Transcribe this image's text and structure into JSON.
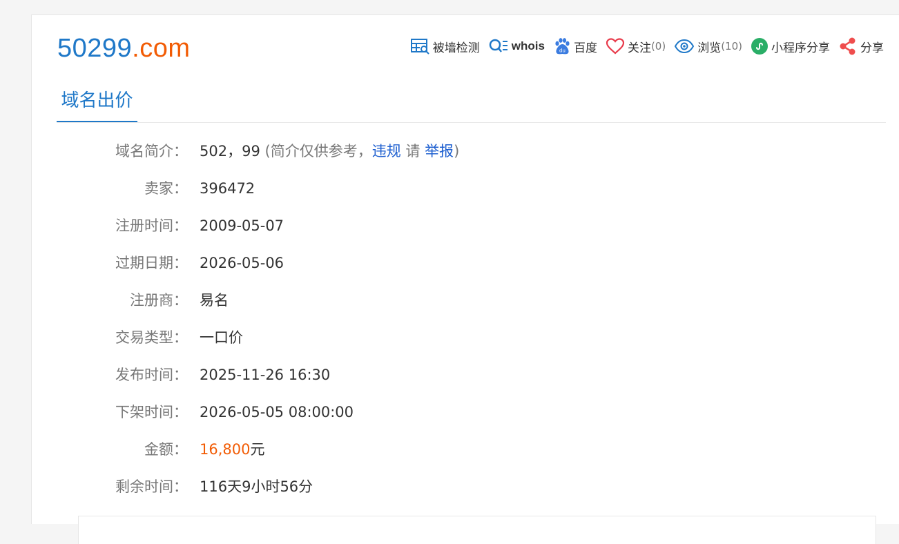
{
  "domain": {
    "name": "50299",
    "tld": ".com"
  },
  "toolbar": {
    "wall_check": "被墙检测",
    "whois": "whois",
    "baidu": "百度",
    "follow": "关注",
    "follow_count": "(0)",
    "views": "浏览",
    "views_count": "(10)",
    "miniprogram_share": "小程序分享",
    "share": "分享"
  },
  "tabs": {
    "active": "域名出价"
  },
  "info": {
    "intro": {
      "label": "域名简介：",
      "value": "502，99",
      "note_open": "(简介仅供参考，",
      "violation": "违规",
      "please": " 请 ",
      "report": "举报",
      "note_close": ")"
    },
    "seller": {
      "label": "卖家：",
      "value": "396472"
    },
    "reg_date": {
      "label": "注册时间：",
      "value": "2009-05-07"
    },
    "expire_date": {
      "label": "过期日期：",
      "value": "2026-05-06"
    },
    "registrar": {
      "label": "注册商：",
      "value": "易名"
    },
    "trade_type": {
      "label": "交易类型：",
      "value": "一口价"
    },
    "publish_time": {
      "label": "发布时间：",
      "value": "2025-11-26 16:30"
    },
    "offshelf_time": {
      "label": "下架时间：",
      "value": "2026-05-05 08:00:00"
    },
    "price": {
      "label": "金额：",
      "amount": "16,800",
      "unit": "元"
    },
    "remaining": {
      "label": "剩余时间：",
      "value": "116天9小时56分"
    }
  },
  "colors": {
    "brand_blue": "#1f78c8",
    "accent_orange": "#f25c05",
    "link_blue": "#1f60d0"
  }
}
